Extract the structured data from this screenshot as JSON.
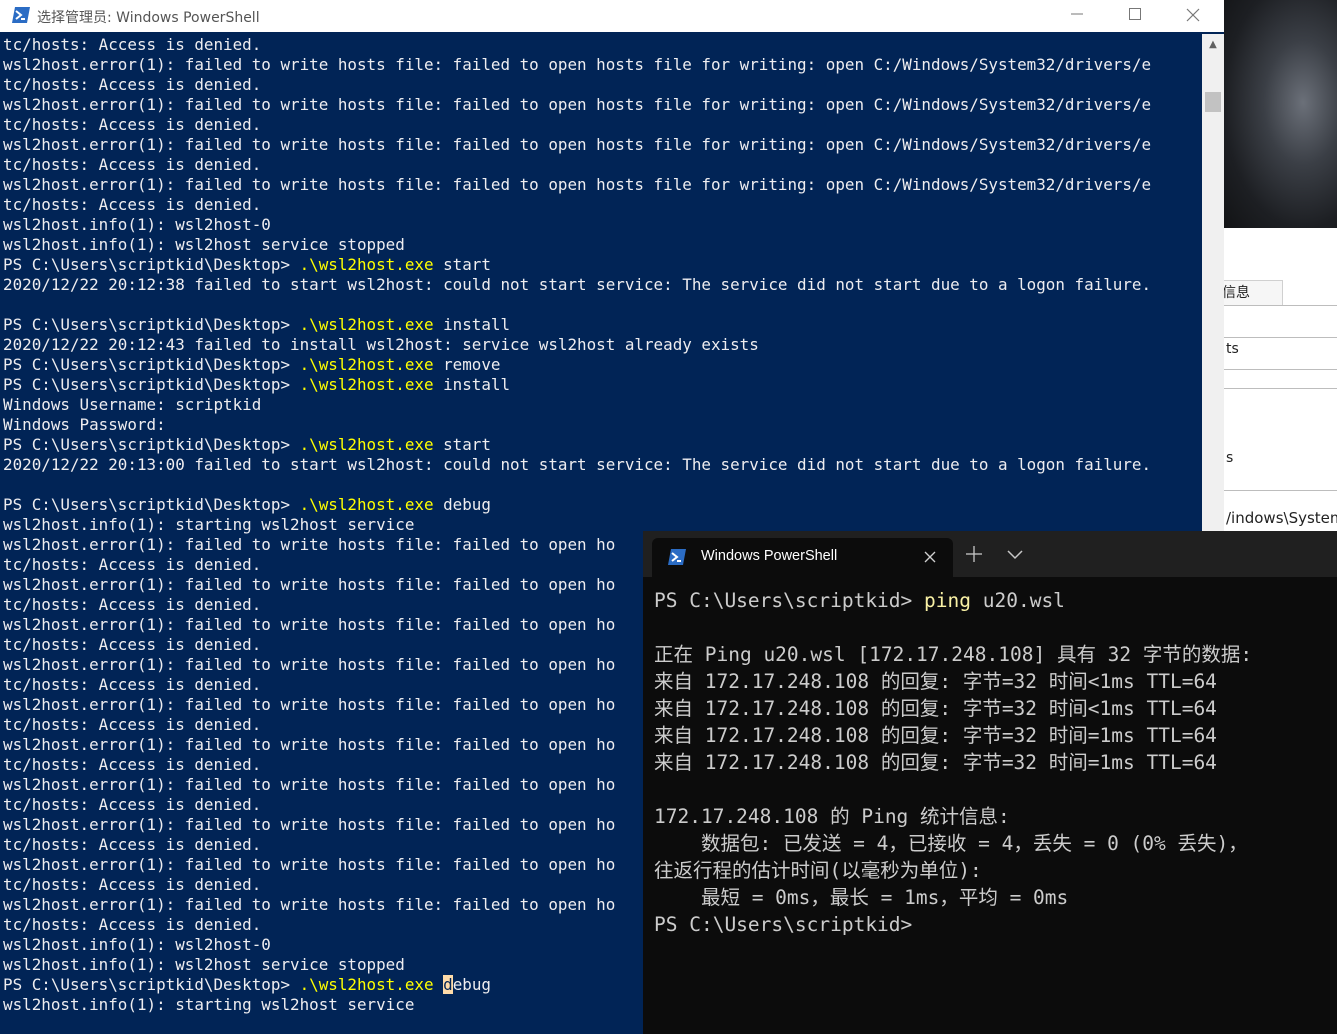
{
  "background_window": {
    "tab_label": "信息",
    "fragment_1": "ts",
    "fragment_2": "s",
    "fragment_3": "/indows\\System"
  },
  "admin_window": {
    "title": "选择管理员: Windows PowerShell",
    "colors": {
      "background": "#012456",
      "text": "#eeedf0",
      "command": "#ffff00",
      "cursor": "#fedba9"
    },
    "lines": [
      [
        "tc/hosts: Access is denied."
      ],
      [
        "wsl2host.error(1): failed to write hosts file: failed to open hosts file for writing: open C:/Windows/System32/drivers/e"
      ],
      [
        "tc/hosts: Access is denied."
      ],
      [
        "wsl2host.error(1): failed to write hosts file: failed to open hosts file for writing: open C:/Windows/System32/drivers/e"
      ],
      [
        "tc/hosts: Access is denied."
      ],
      [
        "wsl2host.error(1): failed to write hosts file: failed to open hosts file for writing: open C:/Windows/System32/drivers/e"
      ],
      [
        "tc/hosts: Access is denied."
      ],
      [
        "wsl2host.error(1): failed to write hosts file: failed to open hosts file for writing: open C:/Windows/System32/drivers/e"
      ],
      [
        "tc/hosts: Access is denied."
      ],
      [
        "wsl2host.info(1): wsl2host-0"
      ],
      [
        "wsl2host.info(1): wsl2host service stopped"
      ],
      [
        "PS C:\\Users\\scriptkid\\Desktop> ",
        ".\\wsl2host.exe",
        " start"
      ],
      [
        "2020/12/22 20:12:38 failed to start wsl2host: could not start service: The service did not start due to a logon failure."
      ],
      [
        ""
      ],
      [
        "PS C:\\Users\\scriptkid\\Desktop> ",
        ".\\wsl2host.exe",
        " install"
      ],
      [
        "2020/12/22 20:12:43 failed to install wsl2host: service wsl2host already exists"
      ],
      [
        "PS C:\\Users\\scriptkid\\Desktop> ",
        ".\\wsl2host.exe",
        " remove"
      ],
      [
        "PS C:\\Users\\scriptkid\\Desktop> ",
        ".\\wsl2host.exe",
        " install"
      ],
      [
        "Windows Username: scriptkid"
      ],
      [
        "Windows Password:"
      ],
      [
        "PS C:\\Users\\scriptkid\\Desktop> ",
        ".\\wsl2host.exe",
        " start"
      ],
      [
        "2020/12/22 20:13:00 failed to start wsl2host: could not start service: The service did not start due to a logon failure."
      ],
      [
        ""
      ],
      [
        "PS C:\\Users\\scriptkid\\Desktop> ",
        ".\\wsl2host.exe",
        " debug"
      ],
      [
        "wsl2host.info(1): starting wsl2host service"
      ],
      [
        "wsl2host.error(1): failed to write hosts file: failed to open ho"
      ],
      [
        "tc/hosts: Access is denied."
      ],
      [
        "wsl2host.error(1): failed to write hosts file: failed to open ho"
      ],
      [
        "tc/hosts: Access is denied."
      ],
      [
        "wsl2host.error(1): failed to write hosts file: failed to open ho"
      ],
      [
        "tc/hosts: Access is denied."
      ],
      [
        "wsl2host.error(1): failed to write hosts file: failed to open ho"
      ],
      [
        "tc/hosts: Access is denied."
      ],
      [
        "wsl2host.error(1): failed to write hosts file: failed to open ho"
      ],
      [
        "tc/hosts: Access is denied."
      ],
      [
        "wsl2host.error(1): failed to write hosts file: failed to open ho"
      ],
      [
        "tc/hosts: Access is denied."
      ],
      [
        "wsl2host.error(1): failed to write hosts file: failed to open ho"
      ],
      [
        "tc/hosts: Access is denied."
      ],
      [
        "wsl2host.error(1): failed to write hosts file: failed to open ho"
      ],
      [
        "tc/hosts: Access is denied."
      ],
      [
        "wsl2host.error(1): failed to write hosts file: failed to open ho"
      ],
      [
        "tc/hosts: Access is denied."
      ],
      [
        "wsl2host.error(1): failed to write hosts file: failed to open ho"
      ],
      [
        "tc/hosts: Access is denied."
      ],
      [
        "wsl2host.info(1): wsl2host-0"
      ],
      [
        "wsl2host.info(1): wsl2host service stopped"
      ],
      [
        "PS C:\\Users\\scriptkid\\Desktop> ",
        ".\\wsl2host.exe",
        " ",
        "d",
        "ebug"
      ],
      [
        "wsl2host.info(1): starting wsl2host service"
      ]
    ]
  },
  "terminal_window": {
    "tab_title": "Windows PowerShell",
    "colors": {
      "background": "#0c0c0c",
      "tabbar": "#202020",
      "text": "#cccccc",
      "command": "#f9f1a5"
    },
    "lines": [
      [
        "PS C:\\Users\\scriptkid> ",
        "ping",
        " u20.wsl"
      ],
      [
        ""
      ],
      [
        "正在 Ping u20.wsl [172.17.248.108] 具有 32 字节的数据:"
      ],
      [
        "来自 172.17.248.108 的回复: 字节=32 时间<1ms TTL=64"
      ],
      [
        "来自 172.17.248.108 的回复: 字节=32 时间<1ms TTL=64"
      ],
      [
        "来自 172.17.248.108 的回复: 字节=32 时间=1ms TTL=64"
      ],
      [
        "来自 172.17.248.108 的回复: 字节=32 时间=1ms TTL=64"
      ],
      [
        ""
      ],
      [
        "172.17.248.108 的 Ping 统计信息:"
      ],
      [
        "    数据包: 已发送 = 4，已接收 = 4，丢失 = 0 (0% 丢失)，"
      ],
      [
        "往返行程的估计时间(以毫秒为单位):"
      ],
      [
        "    最短 = 0ms，最长 = 1ms，平均 = 0ms"
      ],
      [
        "PS C:\\Users\\scriptkid>"
      ]
    ]
  }
}
